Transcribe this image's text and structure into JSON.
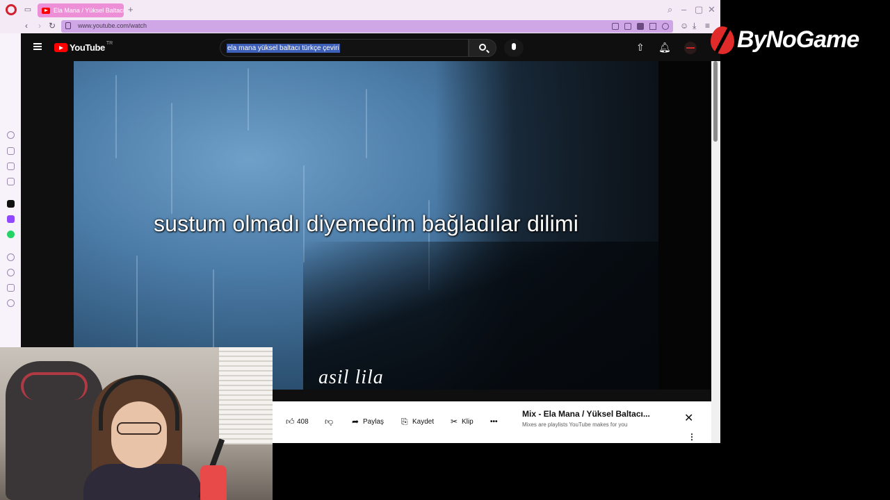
{
  "browser": {
    "tab_title": "Ela Mana / Yüksel Baltacı",
    "url": "www.youtube.com/watch"
  },
  "youtube": {
    "logo_text": "YouTube",
    "country_code": "TR",
    "search_query": "ela mana yüksel baltacı türkçe çeviri",
    "video": {
      "subtitle": "sustum olmadı diyemedim bağladılar dilimi",
      "watermark": "asil lila"
    },
    "actions": {
      "like_count": "408",
      "share_label": "Paylaş",
      "save_label": "Kaydet",
      "clip_label": "Klip"
    },
    "mix_panel": {
      "title": "Mix - Ela Mana / Yüksel Baltacı...",
      "subtitle": "Mixes are playlists YouTube makes for you"
    }
  },
  "overlay": {
    "brand": "ByNoGame"
  },
  "colors": {
    "youtube_red": "#ff0000",
    "opera_tab_active": "#ec8fd6",
    "address_bar": "#cfa6e6",
    "brand_red": "#e12a2a"
  }
}
